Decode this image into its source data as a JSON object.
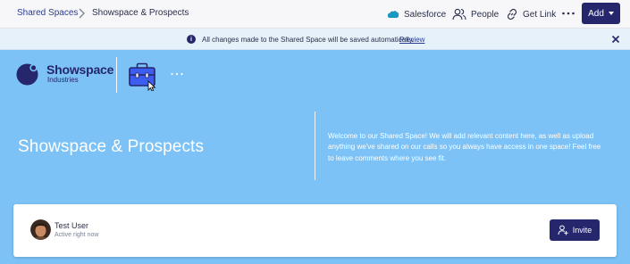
{
  "topbar": {
    "breadcrumb_root": "Shared Spaces",
    "breadcrumb_current": "Showspace & Prospects",
    "salesforce_label": "Salesforce",
    "people_label": "People",
    "getlink_label": "Get Link",
    "add_label": "Add"
  },
  "banner": {
    "info_glyph": "i",
    "message": "All changes made to the Shared Space will be saved automatically.",
    "preview_link": "Preview"
  },
  "hero": {
    "logo_name": "Showspace",
    "logo_subtitle": "Industries",
    "title": "Showspace & Prospects",
    "description": "Welcome to our Shared Space! We will add relevant content here, as well as upload anything we've shared on our calls so you always have access in one space! Feel free to leave comments where you see fit."
  },
  "member_card": {
    "user_name": "Test User",
    "user_status": "Active right now",
    "invite_label": "Invite"
  },
  "colors": {
    "primary": "#25266b",
    "hero_bg": "#7cc2f6",
    "banner_bg": "#e6f1fa",
    "salesforce": "#1798c1"
  },
  "icons": [
    "chevron-right-icon",
    "salesforce-cloud-icon",
    "people-icon",
    "link-icon",
    "more-horizontal-icon",
    "caret-down-icon",
    "info-icon",
    "close-icon",
    "briefcase-icon",
    "cursor-icon",
    "add-user-icon"
  ]
}
